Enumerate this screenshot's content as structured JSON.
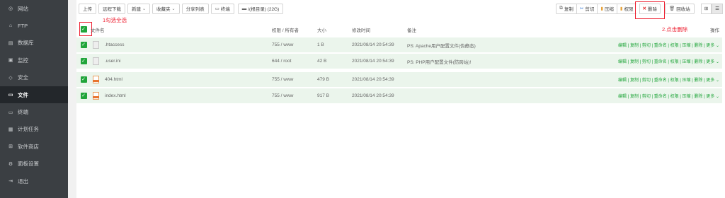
{
  "sidebar": {
    "items": [
      {
        "label": "网站",
        "icon": "globe-icon"
      },
      {
        "label": "FTP",
        "icon": "ftp-icon"
      },
      {
        "label": "数据库",
        "icon": "database-icon"
      },
      {
        "label": "监控",
        "icon": "monitor-icon"
      },
      {
        "label": "安全",
        "icon": "shield-icon"
      },
      {
        "label": "文件",
        "icon": "folder-icon",
        "active": true
      },
      {
        "label": "终端",
        "icon": "terminal-icon"
      },
      {
        "label": "计划任务",
        "icon": "calendar-icon"
      },
      {
        "label": "软件商店",
        "icon": "store-icon"
      },
      {
        "label": "面板设置",
        "icon": "settings-icon"
      },
      {
        "label": "退出",
        "icon": "logout-icon"
      }
    ]
  },
  "toolbar": {
    "upload": "上传",
    "remote_download": "远程下载",
    "new": "新建",
    "favorites": "收藏夹",
    "share_list": "分享列表",
    "terminal": "终端",
    "path": "/(根目录) (22G)"
  },
  "toolbar_right": {
    "copy": "复制",
    "cut": "剪切",
    "compress": "压缩",
    "permission": "权限",
    "delete": "删除",
    "recycle_bin": "回收站"
  },
  "annotations": {
    "step1": "1勾选全选",
    "step2": "2.点击删除"
  },
  "table": {
    "headers": {
      "name": "文件名",
      "permission": "权限 / 所有者",
      "size": "大小",
      "modified": "修改时间",
      "note": "备注",
      "ops": "操作"
    },
    "ops_text": "编辑 | 复制 | 剪切 | 重命名 | 权限 | 压缩 | 删除 | 更多",
    "rows": [
      {
        "name": ".htaccess",
        "type": "txt",
        "perm": "755 / www",
        "size": "1 B",
        "time": "2021/08/14 20:54:39",
        "note": "PS: Apache用户配置文件(伪静态)"
      },
      {
        "name": ".user.ini",
        "type": "txt",
        "perm": "644 / root",
        "size": "42 B",
        "time": "2021/08/14 20:54:39",
        "note": "PS: PHP用户配置文件(防跨站)!"
      },
      {
        "name": "404.html",
        "type": "html",
        "perm": "755 / www",
        "size": "479 B",
        "time": "2021/08/14 20:54:39",
        "note": ""
      },
      {
        "name": "index.html",
        "type": "html",
        "perm": "755 / www",
        "size": "917 B",
        "time": "2021/08/14 20:54:39",
        "note": ""
      }
    ]
  },
  "colors": {
    "accent": "#20a53a",
    "sidebar_bg": "#3b3f43",
    "row_bg": "#ebf5ec",
    "annotation": "#e22233"
  }
}
